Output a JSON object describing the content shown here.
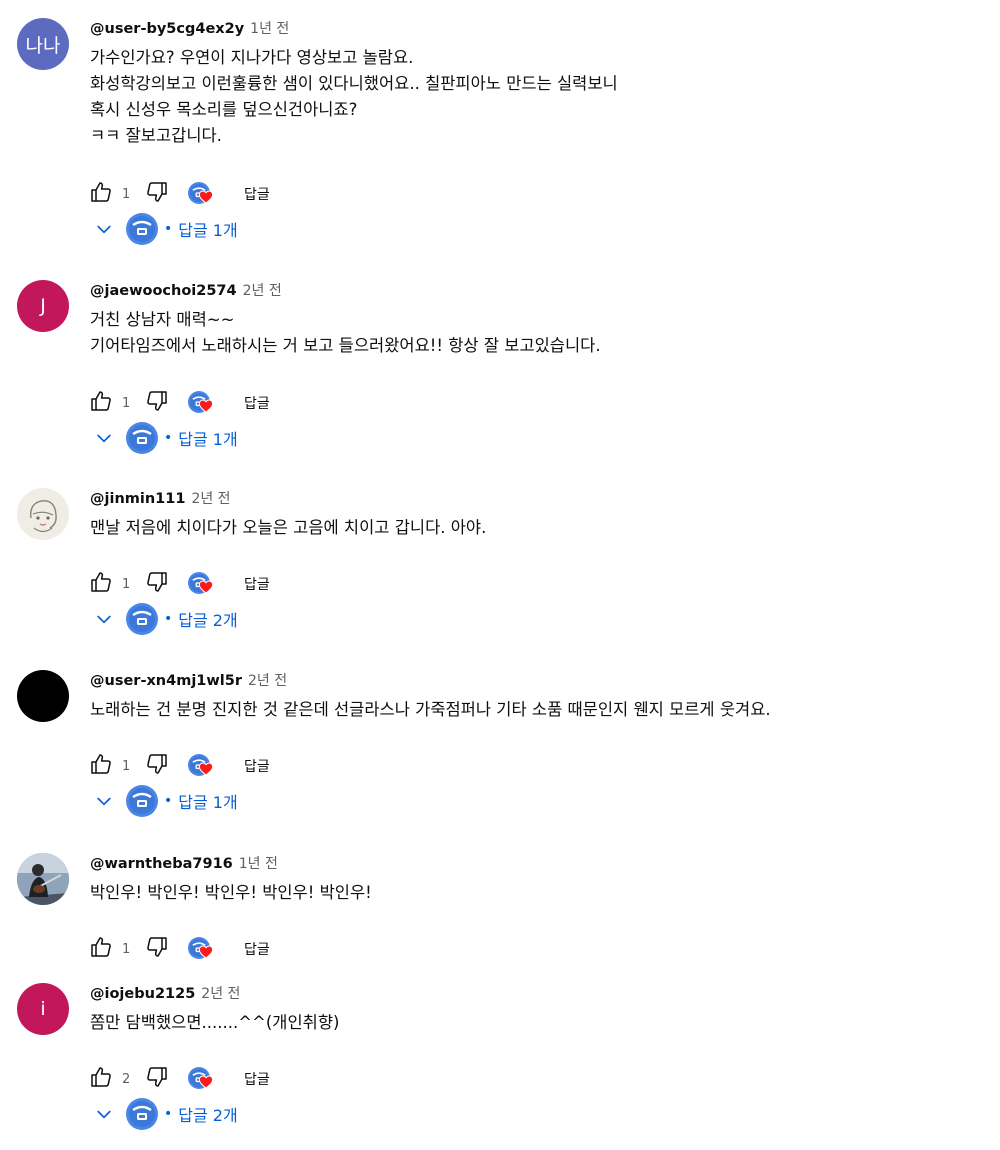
{
  "comments": [
    {
      "author": "@user-by5cg4ex2y",
      "time": "1년 전",
      "avatar": {
        "type": "text",
        "text": "나나",
        "color": "#5c6bc0"
      },
      "lines": [
        "가수인가요? 우연이 지나가다 영상보고 놀람요.",
        "화성학강의보고 이런훌륭한 샘이 있다니했어요.. 칠판피아노 만드는 실력보니",
        "혹시 신성우 목소리를 덮으신건아니죠?",
        "ㅋㅋ 잘보고갑니다."
      ],
      "likes": "1",
      "reply_label": "답글",
      "replies": "답글 1개"
    },
    {
      "author": "@jaewoochoi2574",
      "time": "2년 전",
      "avatar": {
        "type": "text",
        "text": "J",
        "color": "#c2185b"
      },
      "lines": [
        "거친 상남자 매력~~",
        "기어타임즈에서 노래하시는 거 보고 들으러왔어요!! 항상 잘 보고있습니다."
      ],
      "likes": "1",
      "reply_label": "답글",
      "replies": "답글 1개"
    },
    {
      "author": "@jinmin111",
      "time": "2년 전",
      "avatar": {
        "type": "drawing",
        "text": "",
        "color": "#f0eee8"
      },
      "lines": [
        "맨날 저음에 치이다가 오늘은 고음에 치이고 갑니다. 아야."
      ],
      "likes": "1",
      "reply_label": "답글",
      "replies": "답글 2개"
    },
    {
      "author": "@user-xn4mj1wl5r",
      "time": "2년 전",
      "avatar": {
        "type": "solid",
        "text": "",
        "color": "#000000"
      },
      "lines": [
        "노래하는 건 분명 진지한 것 같은데 선글라스나 가죽점퍼나 기타 소품 때문인지 웬지 모르게 웃겨요."
      ],
      "likes": "1",
      "reply_label": "답글",
      "replies": "답글 1개"
    },
    {
      "author": "@warntheba7916",
      "time": "1년 전",
      "avatar": {
        "type": "photo",
        "text": "",
        "color": "#7b8fa6"
      },
      "lines": [
        "박인우! 박인우! 박인우! 박인우! 박인우!"
      ],
      "likes": "1",
      "reply_label": "답글",
      "replies": ""
    },
    {
      "author": "@iojebu2125",
      "time": "2년 전",
      "avatar": {
        "type": "text",
        "text": "i",
        "color": "#c2185b"
      },
      "lines": [
        "쫌만 담백했으면.......^^(개인취향)"
      ],
      "likes": "2",
      "reply_label": "답글",
      "replies": "답글 2개"
    }
  ],
  "icons": {
    "like": "thumbs-up-icon",
    "dislike": "thumbs-down-icon",
    "creator_heart": "creator-heart-icon",
    "chevron": "chevron-down-icon"
  },
  "colors": {
    "link_blue": "#065fd4",
    "heart_red": "#ff0000",
    "meta_gray": "#606060"
  }
}
